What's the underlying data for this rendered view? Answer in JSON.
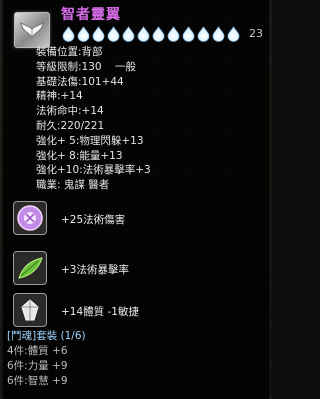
{
  "item": {
    "name": "智者靈翼",
    "enhance_level": "23",
    "star_count": 12,
    "star_color": "#e8f6ff"
  },
  "stats": [
    "裝備位置:背部",
    "等級限制:130    一般",
    "基礎法傷:101+44",
    "精神:+14",
    "法術命中:+14",
    "耐久:220/221",
    "強化+ 5:物理閃躲+13",
    "強化+ 8:能量+13",
    "強化+10:法術暴擊率+3",
    "職業: 鬼謀 醫者"
  ],
  "affixes": [
    {
      "icon": "purple-orb-gem-icon",
      "text": "+25法術傷害"
    },
    {
      "icon": "green-leaf-gem-icon",
      "text": "+3法術暴擊率"
    },
    {
      "icon": "white-crystal-gem-icon",
      "text": "+14體質 -1敏捷"
    }
  ],
  "set": {
    "title": "[鬥魂]套裝 (1/6)",
    "bonuses": [
      "4件:體質 +6",
      "6件:力量 +9",
      "6件:智慧 +9"
    ]
  },
  "colors": {
    "name": "#d46ce6",
    "set_title": "#9fd4ff",
    "set_bonus_inactive": "#bdbdbd"
  }
}
